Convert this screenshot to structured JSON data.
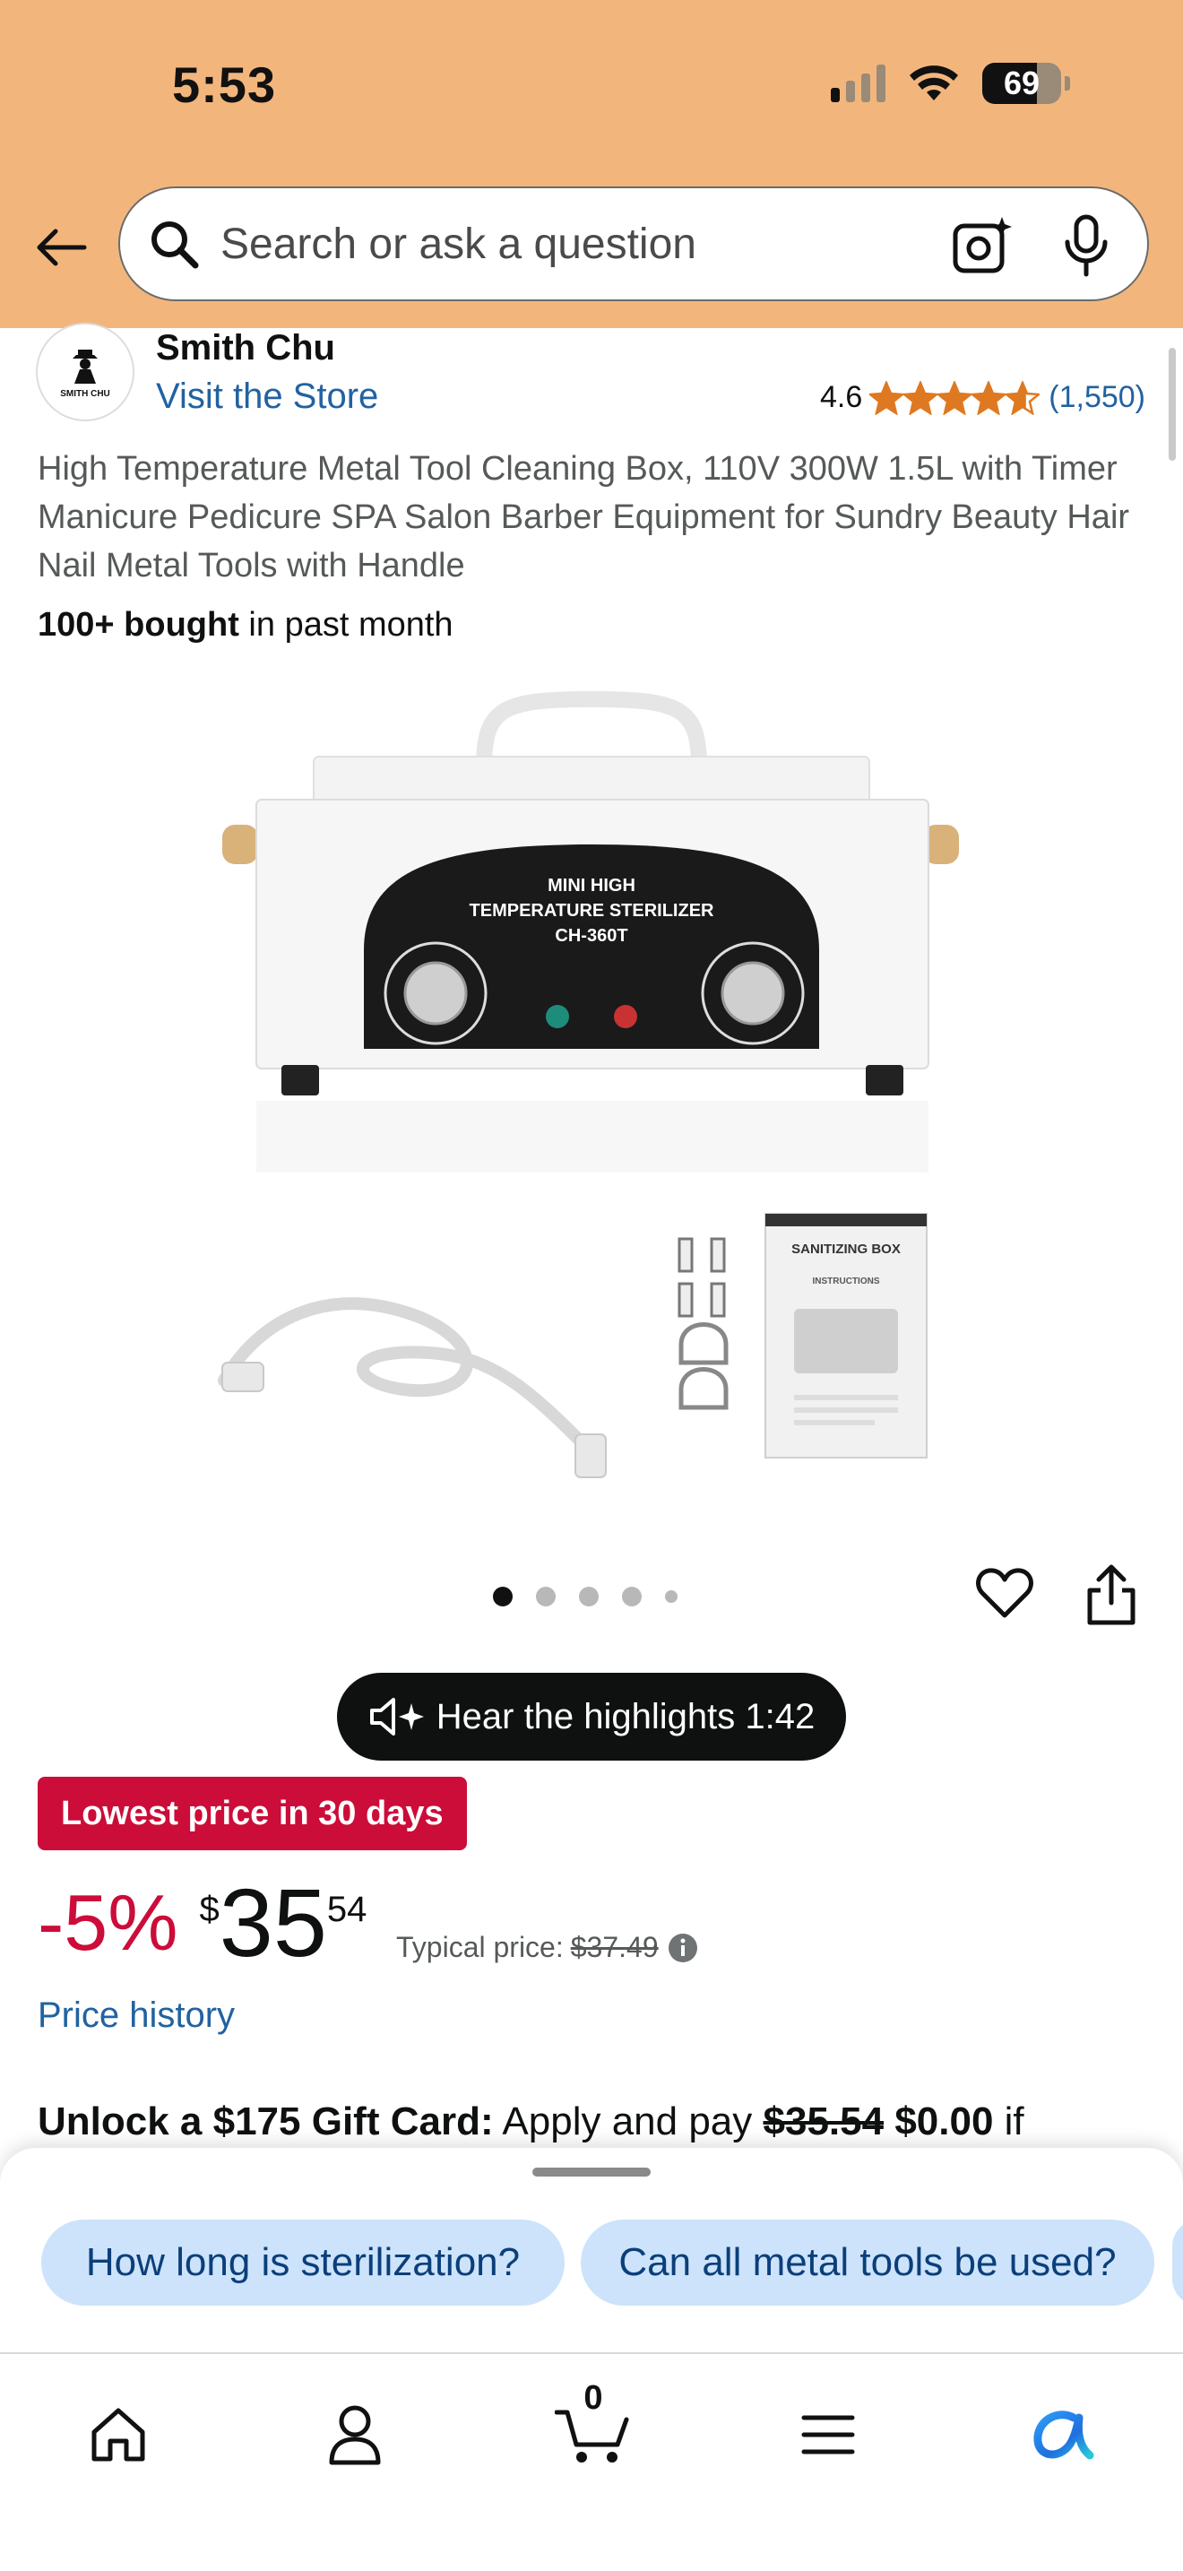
{
  "status_bar": {
    "time": "5:53",
    "battery": "69",
    "battery_level": 0.69,
    "signal_bars_on": 1,
    "signal_bars_total": 4
  },
  "search": {
    "placeholder": "Search or ask a question",
    "icons": [
      "back-arrow-icon",
      "search-icon",
      "camera-lens-icon",
      "microphone-icon"
    ]
  },
  "seller": {
    "logo_text": "SMITH CHU",
    "name": "Smith Chu",
    "visit_store": "Visit the Store"
  },
  "rating": {
    "score": "4.6",
    "stars_value": 4.6,
    "stars_max": 5,
    "count": "(1,550)",
    "star_color": "#de7921"
  },
  "product": {
    "title": "High Temperature Metal Tool Cleaning Box, 110V 300W 1.5L with Timer Manicure Pedicure SPA Salon Barber Equipment for Sundry Beauty Hair Nail Metal Tools with Handle",
    "bought_bold": "100+ bought",
    "bought_rest": " in past month",
    "image": {
      "panel_line1": "MINI HIGH",
      "panel_line2": "TEMPERATURE STERILIZER",
      "panel_line3": "CH-360T",
      "manual_title": "SANITIZING BOX",
      "manual_sub": "INSTRUCTIONS"
    },
    "carousel_dots": 5,
    "carousel_active_index": 0
  },
  "highlights": {
    "label": "Hear the highlights 1:42"
  },
  "deal": {
    "badge": "Lowest price in 30 days",
    "badge_color": "#cc0c39"
  },
  "price": {
    "discount": "-5%",
    "currency": "$",
    "whole": "35",
    "fraction": "54",
    "typical_label": "Typical price:",
    "typical_value": "$37.49",
    "history_link": "Price history"
  },
  "giftcard": {
    "bold": "Unlock a $175 Gift Card:",
    "text": " Apply and pay ",
    "strike": "$35.54",
    "space": " ",
    "free": "$0.00",
    "tail": " if"
  },
  "suggestions": {
    "chips": [
      "How long is sterilization?",
      "Can all metal tools be used?"
    ]
  },
  "bottom_nav": {
    "cart_count": "0",
    "items": [
      "home-icon",
      "account-icon",
      "cart-icon",
      "menu-icon",
      "rufus-ai-icon"
    ]
  },
  "colors": {
    "header_bg": "#f2b67d",
    "link": "#2162a1",
    "chip_bg": "#cde3fb"
  }
}
